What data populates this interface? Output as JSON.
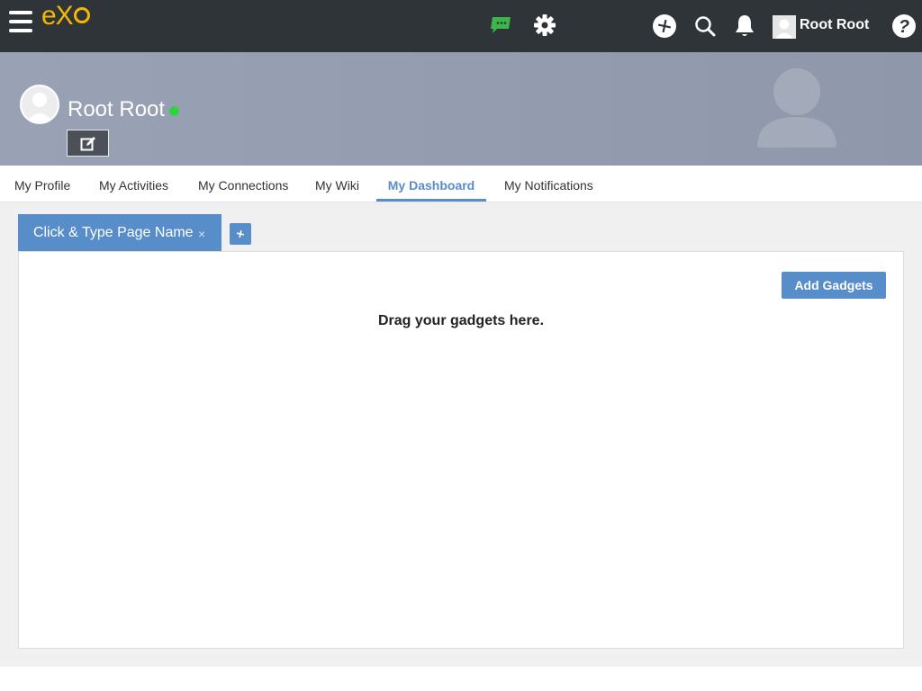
{
  "topbar": {
    "logo_prefix": "eX",
    "user_name": "Root Root"
  },
  "banner": {
    "profile_name": "Root Root",
    "status_color": "#2fd341"
  },
  "tabs": [
    {
      "label": "My Profile"
    },
    {
      "label": "My Activities"
    },
    {
      "label": "My Connections"
    },
    {
      "label": "My Wiki"
    },
    {
      "label": "My Dashboard",
      "active": true
    },
    {
      "label": "My Notifications"
    }
  ],
  "dashboard": {
    "page_tab_label": "Click & Type Page Name",
    "page_tab_close": "×",
    "add_gadgets_label": "Add Gadgets",
    "empty_text": "Drag your gadgets here."
  },
  "colors": {
    "accent": "#578dc9",
    "topbar": "#2f3438",
    "logo": "#f5b800"
  }
}
